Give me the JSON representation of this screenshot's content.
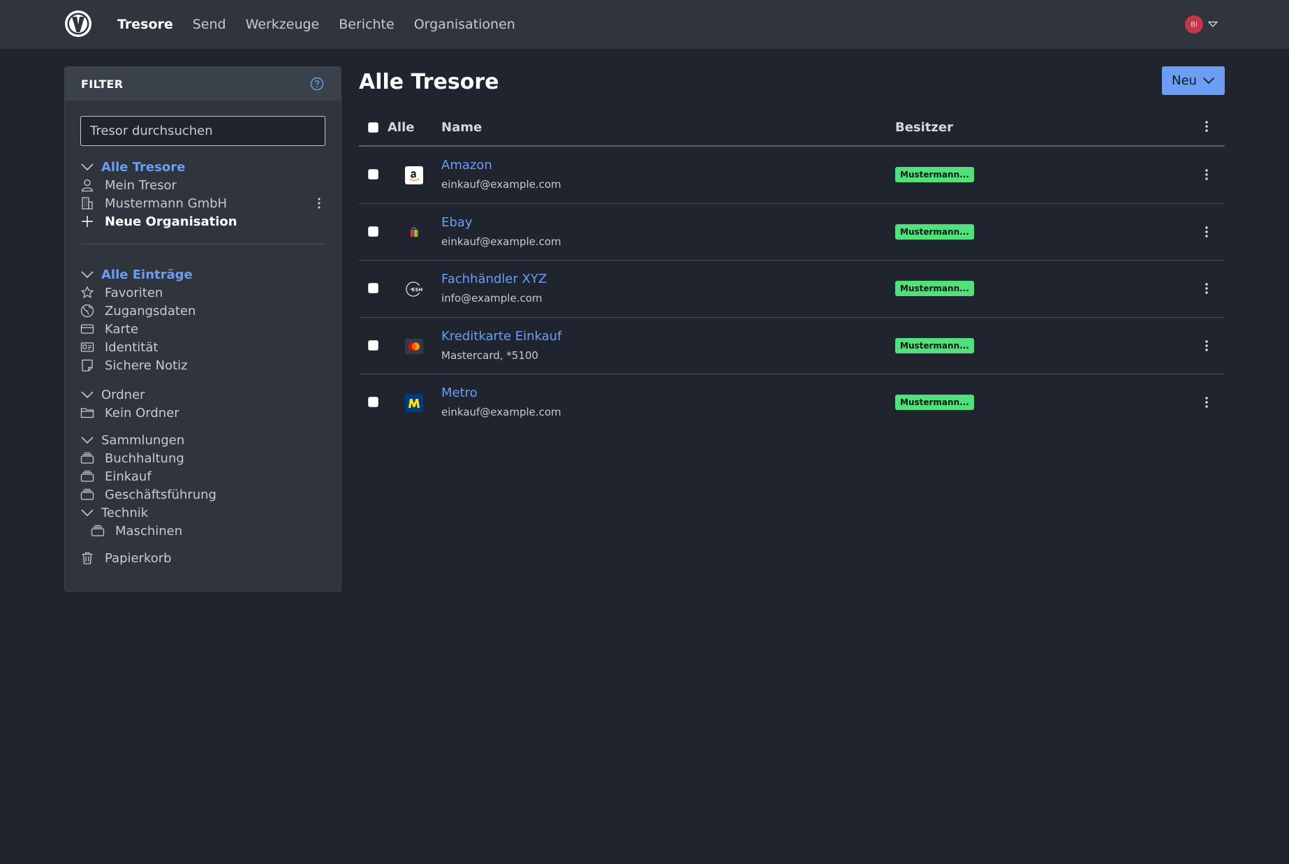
{
  "header": {
    "nav": [
      "Tresore",
      "Send",
      "Werkzeuge",
      "Berichte",
      "Organisationen"
    ],
    "active_index": 0,
    "user_initials": "BI"
  },
  "filter": {
    "title": "FILTER",
    "search_placeholder": "Tresor durchsuchen",
    "vaults_heading": "Alle Tresore",
    "vaults": [
      "Mein Tresor",
      "Mustermann GmbH"
    ],
    "new_org": "Neue Organisation",
    "items_heading": "Alle Einträge",
    "types": [
      "Favoriten",
      "Zugangsdaten",
      "Karte",
      "Identität",
      "Sichere Notiz"
    ],
    "folders_heading": "Ordner",
    "folders": [
      "Kein Ordner"
    ],
    "collections_heading": "Sammlungen",
    "collections": [
      "Buchhaltung",
      "Einkauf",
      "Geschäftsführung"
    ],
    "technik_heading": "Technik",
    "technik_children": [
      "Maschinen"
    ],
    "trash": "Papierkorb"
  },
  "main": {
    "title": "Alle Tresore",
    "new_button": "Neu",
    "columns": {
      "all": "Alle",
      "name": "Name",
      "owner": "Besitzer"
    },
    "rows": [
      {
        "icon": "amazon-icon",
        "name": "Amazon",
        "sub": "einkauf@example.com",
        "owner": "Mustermann..."
      },
      {
        "icon": "ebay-icon",
        "name": "Ebay",
        "sub": "einkauf@example.com",
        "owner": "Mustermann..."
      },
      {
        "icon": "esh-icon",
        "name": "Fachhändler XYZ",
        "sub": "info@example.com",
        "owner": "Mustermann..."
      },
      {
        "icon": "mastercard-icon",
        "name": "Kreditkarte Einkauf",
        "sub": "Mastercard, *5100",
        "owner": "Mustermann..."
      },
      {
        "icon": "metro-icon",
        "name": "Metro",
        "sub": "einkauf@example.com",
        "owner": "Mustermann..."
      }
    ]
  },
  "colors": {
    "accent": "#6b9ef2",
    "badge": "#52e07c",
    "bg": "#1f242e",
    "panel": "#2f343d"
  }
}
